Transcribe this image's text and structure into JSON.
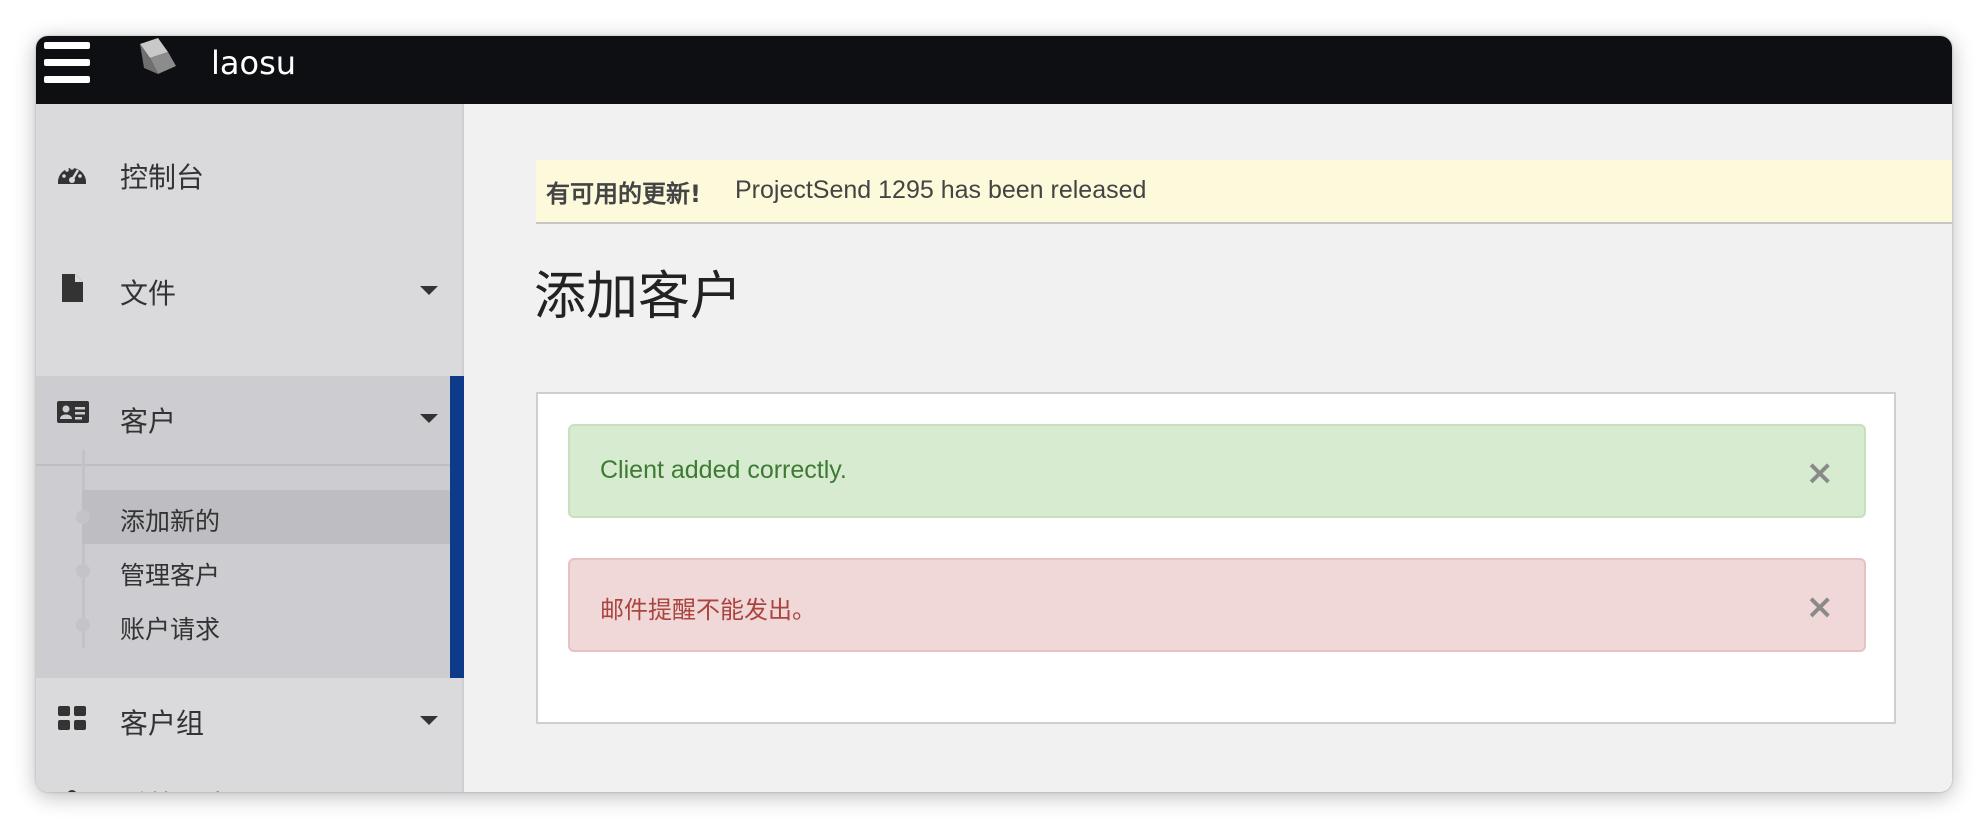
{
  "header": {
    "brand": "laosu",
    "menu_icon": "hamburger-menu-icon",
    "logo_icon": "projectsend-logo-icon"
  },
  "sidebar": {
    "items": [
      {
        "label": "控制台",
        "icon": "dashboard-icon"
      },
      {
        "label": "文件",
        "icon": "file-icon"
      },
      {
        "label": "客户",
        "icon": "id-card-icon",
        "active": true,
        "subitems": [
          {
            "label": "添加新的",
            "selected": true
          },
          {
            "label": "管理客户"
          },
          {
            "label": "账户请求"
          }
        ]
      },
      {
        "label": "客户组",
        "icon": "grid-icon"
      },
      {
        "label": "系统用户",
        "icon": "users-icon"
      }
    ]
  },
  "update_notice": {
    "title": "有可用的更新!",
    "message": "ProjectSend 1295 has been released"
  },
  "main": {
    "title": "添加客户",
    "alerts": [
      {
        "type": "success",
        "text": "Client added correctly.",
        "close": "×"
      },
      {
        "type": "danger",
        "text": "邮件提醒不能发出。",
        "close": "×"
      }
    ]
  },
  "colors": {
    "topbar": "#0e0f12",
    "active_accent": "#0d3b8a",
    "success_bg": "#d6ebd0",
    "danger_bg": "#f0d7d8"
  }
}
